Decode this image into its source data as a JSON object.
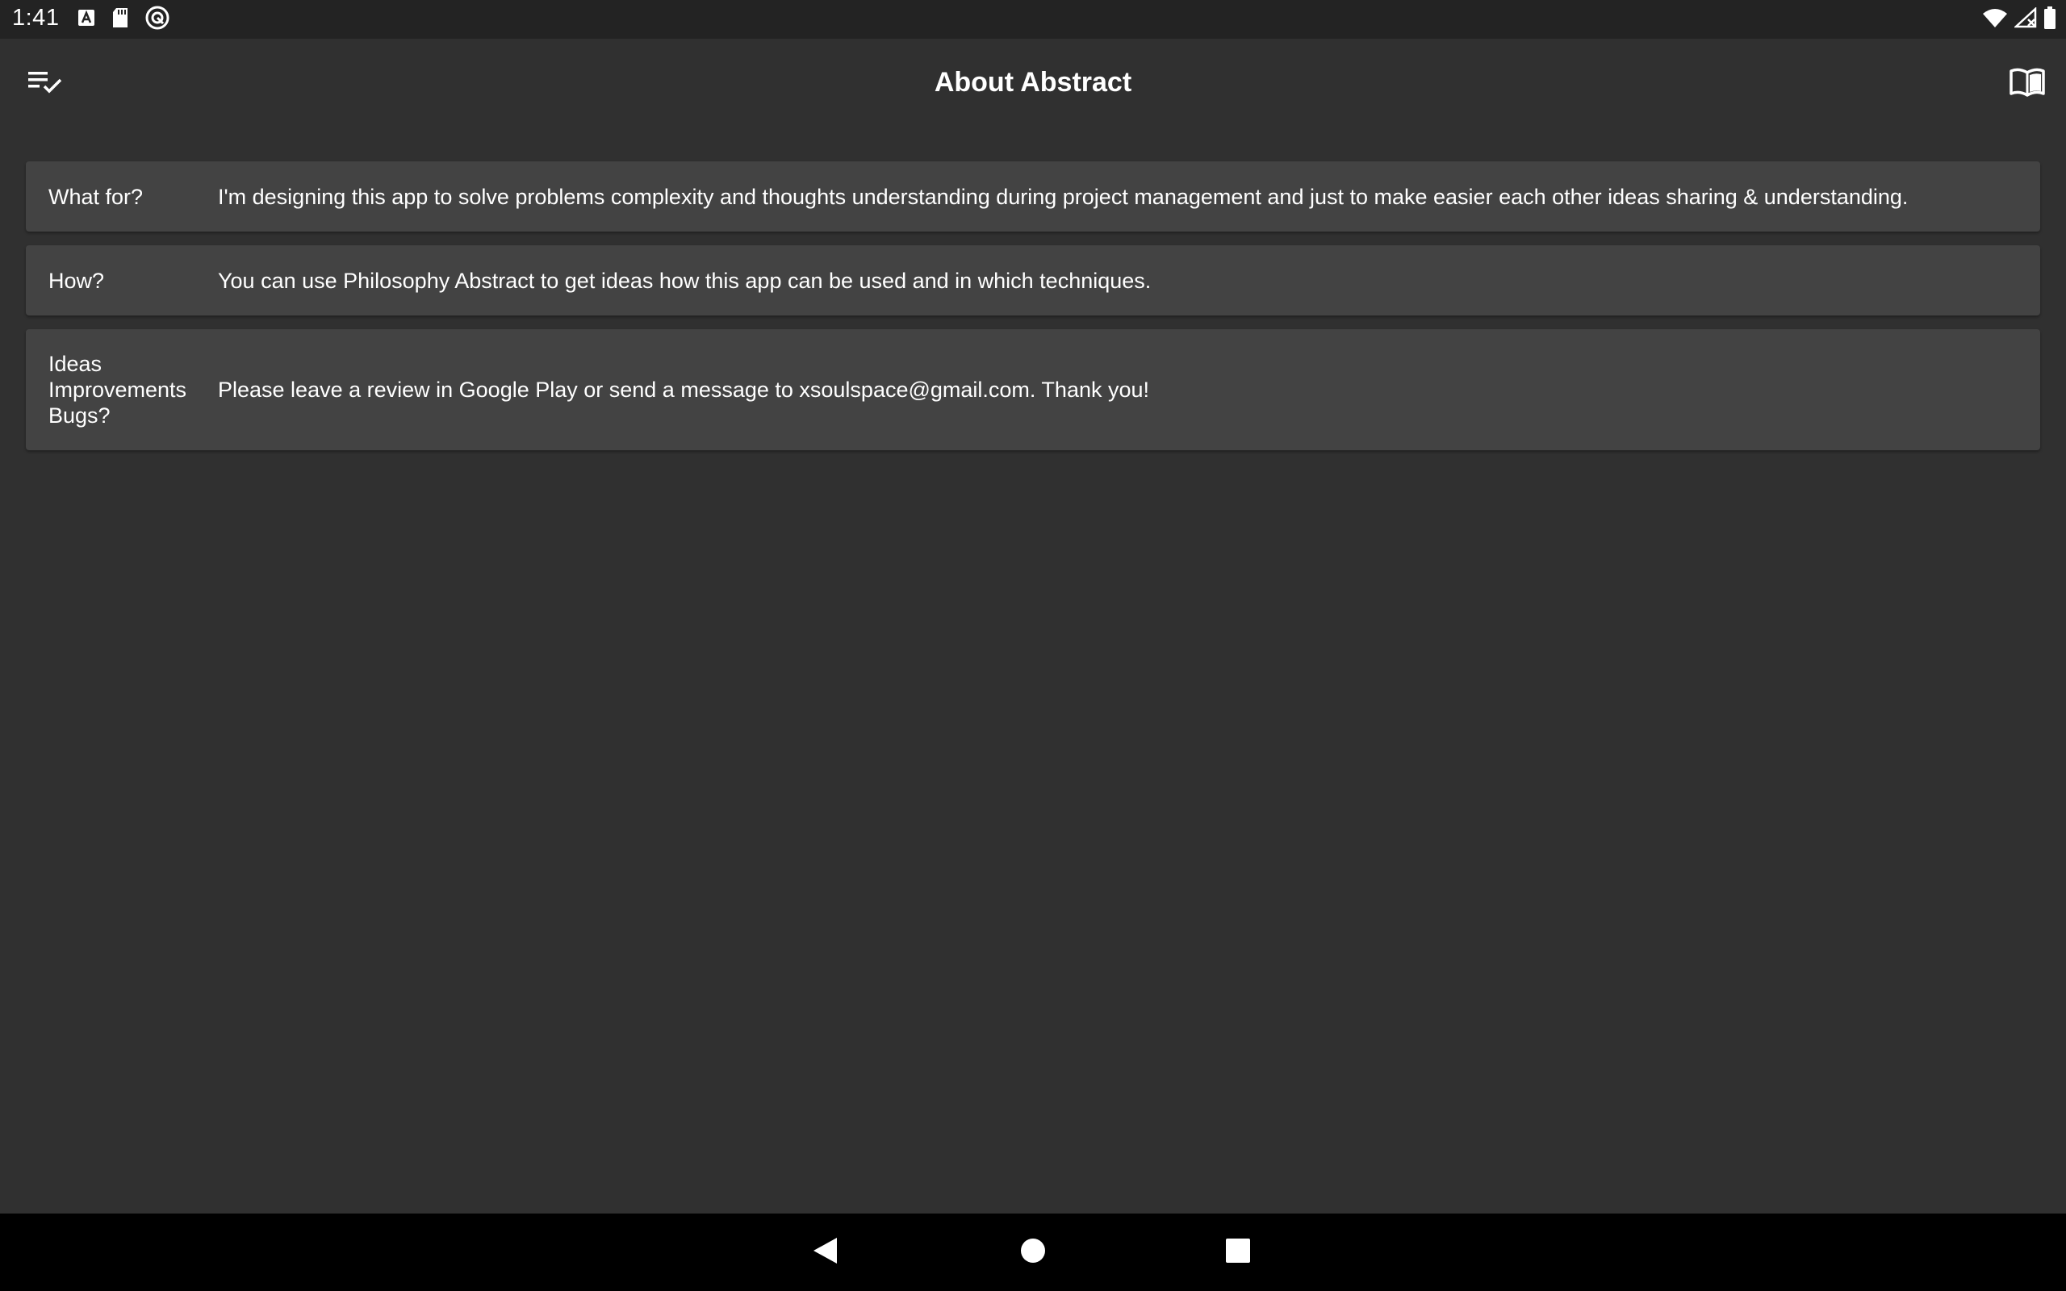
{
  "status_bar": {
    "time": "1:41",
    "left_icons": [
      "text-a-icon",
      "sd-card-icon",
      "sync-circle-icon"
    ],
    "right_icons": [
      "wifi-icon",
      "signal-off-icon",
      "battery-icon"
    ]
  },
  "app_bar": {
    "title": "About Abstract",
    "left_action_icon": "checklist-icon",
    "right_action_icon": "open-book-icon"
  },
  "cards": [
    {
      "label": "What for?",
      "text": "I'm designing this app to solve problems complexity and thoughts understanding during project management and just to make easier each other ideas sharing & understanding."
    },
    {
      "label": "How?",
      "text": "You can use Philosophy Abstract to get ideas how this app can be used and in which techniques."
    },
    {
      "label": "Ideas\nImprovements\nBugs?",
      "text": "Please leave a review in Google Play or send a message to xsoulspace@gmail.com. Thank you!"
    }
  ],
  "nav_bar": {
    "icons": [
      "back-icon",
      "home-icon",
      "recents-icon"
    ]
  },
  "colors": {
    "background": "#303030",
    "status_bar": "#232323",
    "card": "#434343",
    "nav_bar": "#000000",
    "text": "#ffffff"
  }
}
